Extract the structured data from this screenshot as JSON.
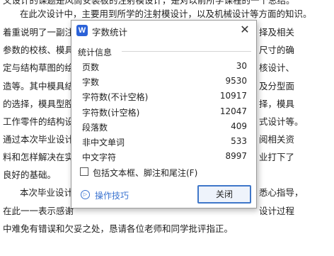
{
  "document": {
    "lines": [
      "文设计的课题是风筒安装板的注射模设计，是对以前所学课程的一个总结。",
      "在此次设计中，主要用到所学的注射模设计，以及机械设计等方面的知识。",
      "着重说明了一副注",
      "参数的校核、模具",
      "定与结构草图的绘",
      "造等。其中模具结",
      "的选择，模具型腔",
      "工作零件的结构设",
      "通过本次毕业设计",
      "料和怎样解决在实",
      "良好的基础。",
      "本次毕业设计",
      "在此一一表示感谢",
      "中难免有错误和欠妥之处，恳请各位老师和同学批评指正。"
    ],
    "right_fragments": [
      "择及相关",
      "尺寸的确",
      "核设计、",
      "及分型面",
      "择，模具",
      "式设计等。",
      "阅相关资",
      "业打下了",
      "悉心指导，",
      "设计过程"
    ]
  },
  "dialog": {
    "title": "字数统计",
    "icon_letter": "W",
    "close_glyph": "✕",
    "group_title": "统计信息",
    "stats": [
      {
        "label": "页数",
        "value": "30"
      },
      {
        "label": "字数",
        "value": "9530"
      },
      {
        "label": "字符数(不计空格)",
        "value": "10917"
      },
      {
        "label": "字符数(计空格)",
        "value": "12047"
      },
      {
        "label": "段落数",
        "value": "409"
      },
      {
        "label": "非中文单词",
        "value": "533"
      },
      {
        "label": "中文字符",
        "value": "8997"
      }
    ],
    "checkbox_label": "包括文本框、脚注和尾注(F)",
    "checkbox_checked": false,
    "tips_label": "操作技巧",
    "tips_icon_glyph": "▷",
    "close_button_label": "关闭"
  }
}
